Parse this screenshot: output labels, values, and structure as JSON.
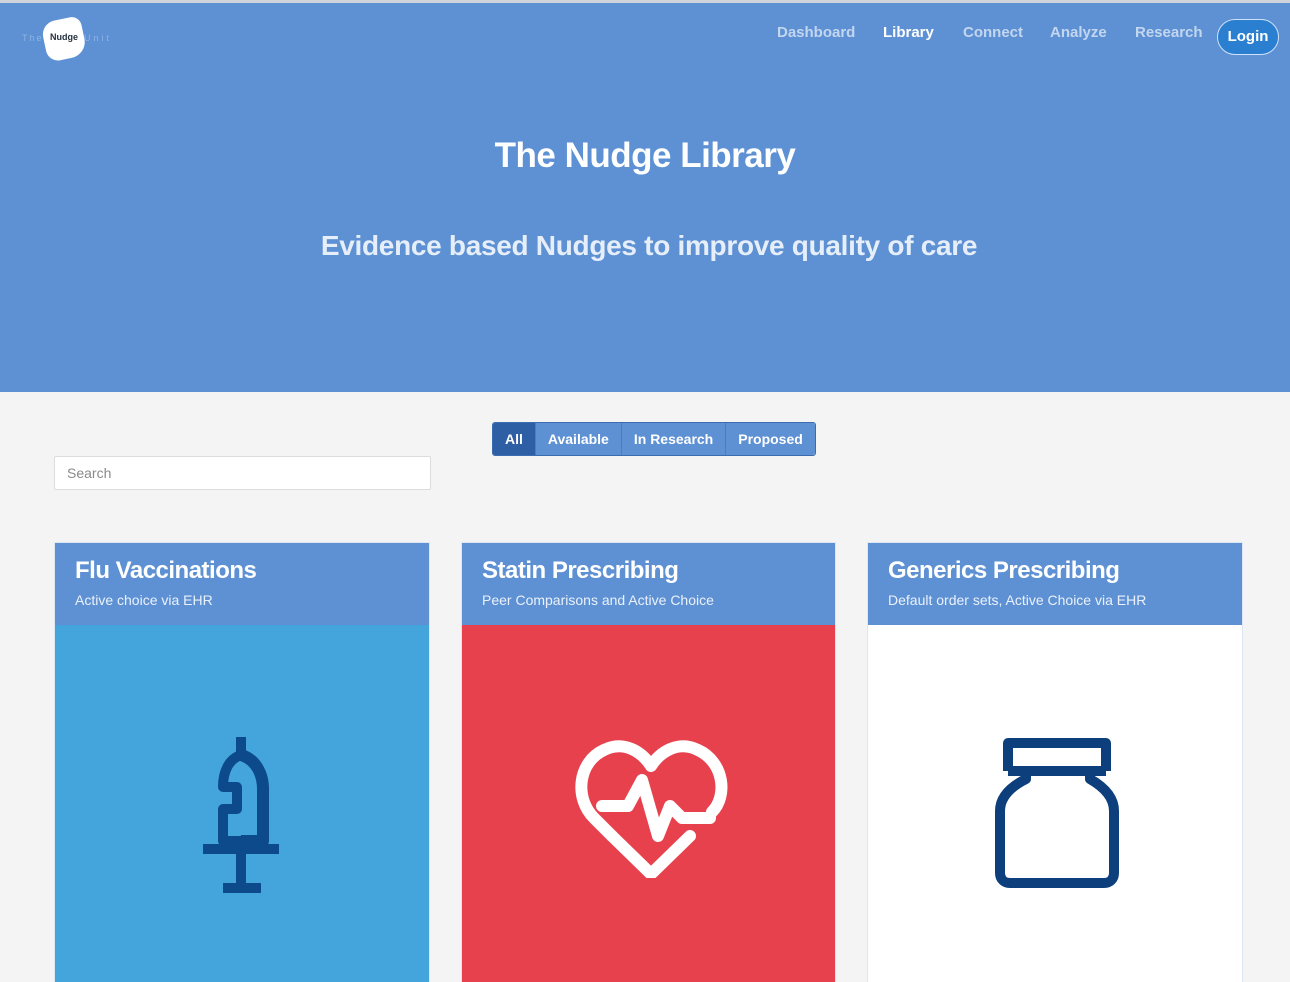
{
  "brand": {
    "logo_text_left": "The",
    "logo_text_center": "Nudge",
    "logo_text_right": "Unit"
  },
  "nav": {
    "items": [
      {
        "label": "Dashboard",
        "active": false
      },
      {
        "label": "Library",
        "active": true
      },
      {
        "label": "Connect",
        "active": false
      },
      {
        "label": "Analyze",
        "active": false
      },
      {
        "label": "Research",
        "active": false
      }
    ],
    "login_label": "Login"
  },
  "hero": {
    "title": "The Nudge Library",
    "subtitle": "Evidence based Nudges to improve quality of care"
  },
  "filters": {
    "items": [
      {
        "label": "All",
        "active": true
      },
      {
        "label": "Available",
        "active": false
      },
      {
        "label": "In Research",
        "active": false
      },
      {
        "label": "Proposed",
        "active": false
      }
    ]
  },
  "search": {
    "placeholder": "Search",
    "value": ""
  },
  "cards": [
    {
      "title": "Flu Vaccinations",
      "subtitle": "Active choice via EHR",
      "icon": "syringe-icon",
      "image_bg": "#44a5dc",
      "icon_color": "#0d4a8c"
    },
    {
      "title": "Statin Prescribing",
      "subtitle": "Peer Comparisons and Active Choice",
      "icon": "heart-pulse-icon",
      "image_bg": "#e8414e",
      "icon_color": "#ffffff"
    },
    {
      "title": "Generics Prescribing",
      "subtitle": "Default order sets, Active Choice via EHR",
      "icon": "pill-bottle-icon",
      "image_bg": "#ffffff",
      "icon_color": "#0d3f7c"
    }
  ],
  "colors": {
    "primary": "#5e91d3",
    "primary_dark": "#2e5ea3",
    "page_bg": "#f4f4f4",
    "login_bg": "#2a7fd0"
  }
}
